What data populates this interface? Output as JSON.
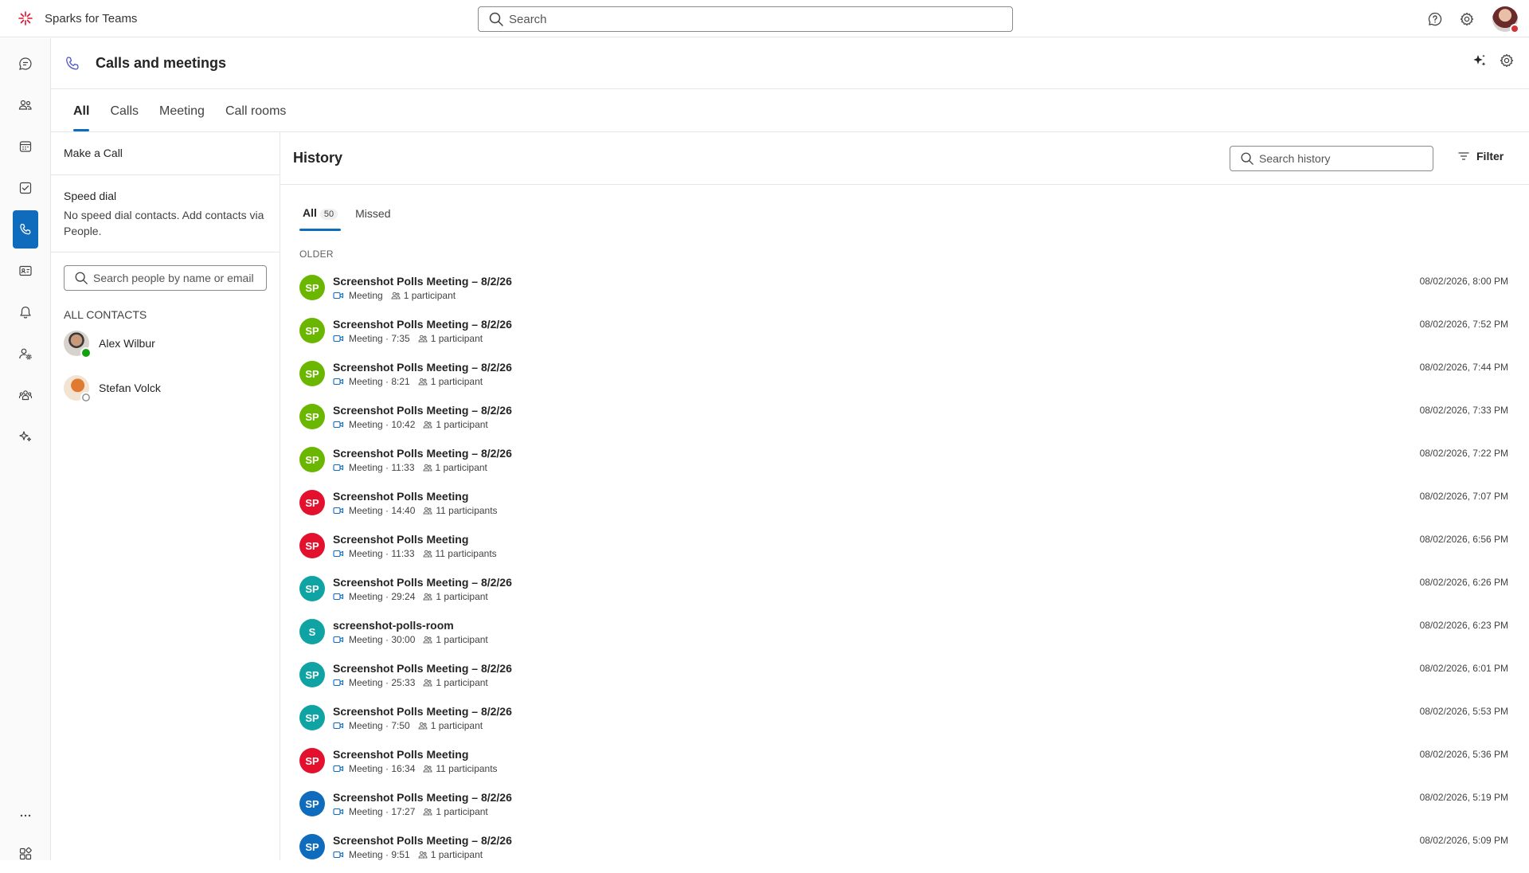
{
  "app": {
    "name": "Sparks for Teams"
  },
  "search": {
    "placeholder": "Search"
  },
  "page": {
    "title": "Calls and meetings"
  },
  "tabs": [
    {
      "label": "All",
      "active": true
    },
    {
      "label": "Calls",
      "active": false
    },
    {
      "label": "Meeting",
      "active": false
    },
    {
      "label": "Call rooms",
      "active": false
    }
  ],
  "left_panel": {
    "make_call": "Make a Call",
    "speed_dial": {
      "title": "Speed dial",
      "description": "No speed dial contacts. Add contacts via People."
    },
    "people_search_placeholder": "Search people by name or email",
    "contacts_heading": "ALL CONTACTS",
    "contacts": [
      {
        "name": "Alex Wilbur",
        "presence": "available"
      },
      {
        "name": "Stefan Volck",
        "presence": "offline"
      }
    ]
  },
  "history": {
    "title": "History",
    "search_placeholder": "Search history",
    "filter_label": "Filter",
    "subtabs": [
      {
        "label": "All",
        "count": "50",
        "active": true
      },
      {
        "label": "Missed",
        "count": "",
        "active": false
      }
    ],
    "section_label": "OLDER",
    "items": [
      {
        "initials": "SP",
        "color": "#6bb700",
        "title": "Screenshot Polls Meeting – 8/2/26",
        "meta": "Meeting",
        "participants": "1 participant",
        "time": "08/02/2026, 8:00 PM"
      },
      {
        "initials": "SP",
        "color": "#6bb700",
        "title": "Screenshot Polls Meeting – 8/2/26",
        "meta": "Meeting · 7:35",
        "participants": "1 participant",
        "time": "08/02/2026, 7:52 PM"
      },
      {
        "initials": "SP",
        "color": "#6bb700",
        "title": "Screenshot Polls Meeting – 8/2/26",
        "meta": "Meeting · 8:21",
        "participants": "1 participant",
        "time": "08/02/2026, 7:44 PM"
      },
      {
        "initials": "SP",
        "color": "#6bb700",
        "title": "Screenshot Polls Meeting – 8/2/26",
        "meta": "Meeting · 10:42",
        "participants": "1 participant",
        "time": "08/02/2026, 7:33 PM"
      },
      {
        "initials": "SP",
        "color": "#6bb700",
        "title": "Screenshot Polls Meeting – 8/2/26",
        "meta": "Meeting · 11:33",
        "participants": "1 participant",
        "time": "08/02/2026, 7:22 PM"
      },
      {
        "initials": "SP",
        "color": "#e3112d",
        "title": "Screenshot Polls Meeting",
        "meta": "Meeting · 14:40",
        "participants": "11 participants",
        "time": "08/02/2026, 7:07 PM"
      },
      {
        "initials": "SP",
        "color": "#e3112d",
        "title": "Screenshot Polls Meeting",
        "meta": "Meeting · 11:33",
        "participants": "11 participants",
        "time": "08/02/2026, 6:56 PM"
      },
      {
        "initials": "SP",
        "color": "#0fa3a3",
        "title": "Screenshot Polls Meeting – 8/2/26",
        "meta": "Meeting · 29:24",
        "participants": "1 participant",
        "time": "08/02/2026, 6:26 PM"
      },
      {
        "initials": "S",
        "color": "#0fa3a3",
        "title": "screenshot-polls-room",
        "meta": "Meeting · 30:00",
        "participants": "1 participant",
        "time": "08/02/2026, 6:23 PM"
      },
      {
        "initials": "SP",
        "color": "#0fa3a3",
        "title": "Screenshot Polls Meeting – 8/2/26",
        "meta": "Meeting · 25:33",
        "participants": "1 participant",
        "time": "08/02/2026, 6:01 PM"
      },
      {
        "initials": "SP",
        "color": "#0fa3a3",
        "title": "Screenshot Polls Meeting – 8/2/26",
        "meta": "Meeting · 7:50",
        "participants": "1 participant",
        "time": "08/02/2026, 5:53 PM"
      },
      {
        "initials": "SP",
        "color": "#e3112d",
        "title": "Screenshot Polls Meeting",
        "meta": "Meeting · 16:34",
        "participants": "11 participants",
        "time": "08/02/2026, 5:36 PM"
      },
      {
        "initials": "SP",
        "color": "#0f6cbd",
        "title": "Screenshot Polls Meeting – 8/2/26",
        "meta": "Meeting · 17:27",
        "participants": "1 participant",
        "time": "08/02/2026, 5:19 PM"
      },
      {
        "initials": "SP",
        "color": "#0f6cbd",
        "title": "Screenshot Polls Meeting – 8/2/26",
        "meta": "Meeting · 9:51",
        "participants": "1 participant",
        "time": "08/02/2026, 5:09 PM"
      }
    ]
  },
  "colors": {
    "accent": "#0f6cbd",
    "available": "#13a10e",
    "offline": "#8a8a8a"
  },
  "icons": {
    "rail": [
      "chat-icon",
      "people-icon",
      "calendar-icon",
      "tasks-icon",
      "calls-icon",
      "contact-card-icon",
      "activity-icon",
      "people-settings-icon",
      "teams-icon",
      "copilot-icon",
      "more-icon",
      "apps-icon"
    ]
  }
}
